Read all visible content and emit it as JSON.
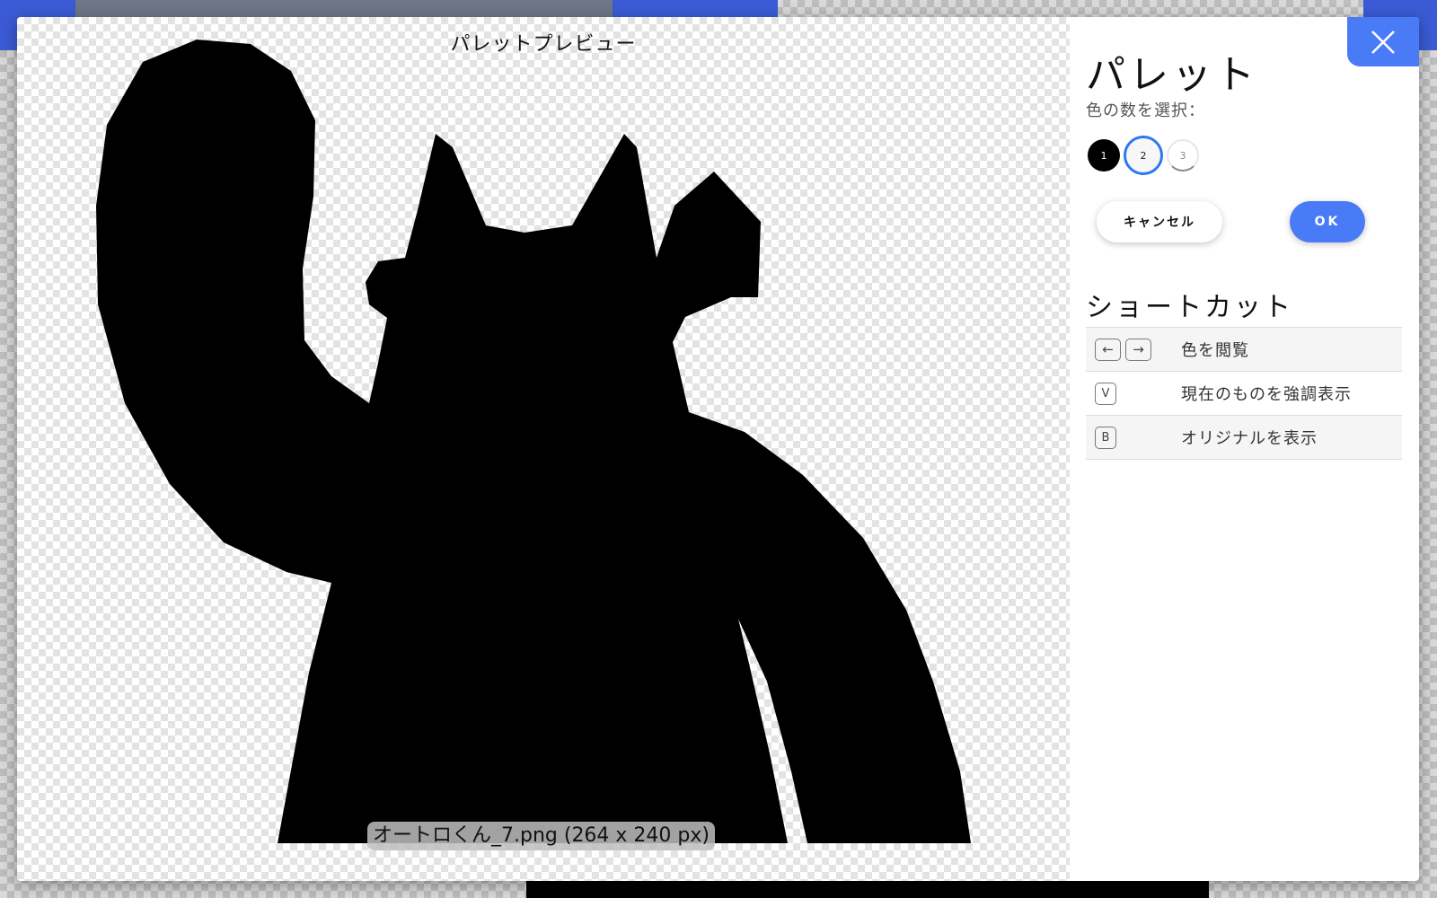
{
  "preview": {
    "title": "パレットプレビュー",
    "file_caption": "オートロくん_7.png (264 x 240 px)"
  },
  "palette": {
    "title": "パレット",
    "color_count_label": "色の数を選択：",
    "options": [
      {
        "label": "1",
        "color": "#000000",
        "state": "filled"
      },
      {
        "label": "2",
        "color": "#f7f7f7",
        "state": "selected"
      },
      {
        "label": "3",
        "color": "#ffffff",
        "state": "unselected"
      }
    ],
    "selected_count": "2",
    "cancel_label": "キャンセル",
    "ok_label": "OK"
  },
  "shortcuts": {
    "title": "ショートカット",
    "rows": [
      {
        "keys": [
          "←",
          "→"
        ],
        "description": "色を閲覧"
      },
      {
        "keys": [
          "V"
        ],
        "description": "現在のものを強調表示"
      },
      {
        "keys": [
          "B"
        ],
        "description": "オリジナルを表示"
      }
    ]
  },
  "colors": {
    "accent": "#4a7bf7",
    "selected_ring": "#2d78f0",
    "silhouette": "#000000"
  },
  "icons": {
    "close": "close-icon"
  }
}
